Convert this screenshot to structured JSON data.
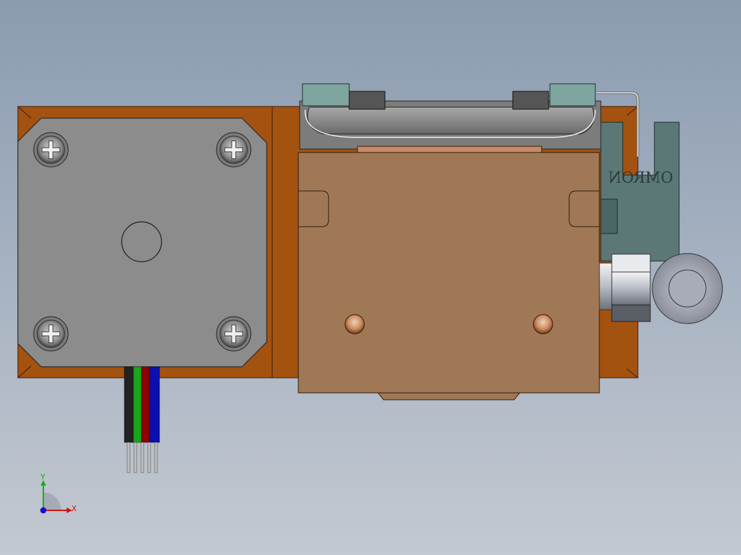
{
  "labels": {
    "brand": "OMRON",
    "axis_x": "X",
    "axis_y": "Y"
  },
  "colors": {
    "background_top": "#8b9bb0",
    "background_bottom": "#c3c9d1",
    "base_plate": "#a4520f",
    "motor_body": "#8c8c8c",
    "carriage": "#a17856",
    "sensor": "#5b7877",
    "wire_black": "#222222",
    "wire_green": "#1aa51a",
    "wire_red": "#8b0000",
    "wire_blue": "#0a10b0",
    "axis_x": "#d01010",
    "axis_y": "#10b010",
    "axis_z": "#1010d0"
  },
  "icons": [
    "phillips-screw-icon",
    "triad-axis-icon"
  ]
}
